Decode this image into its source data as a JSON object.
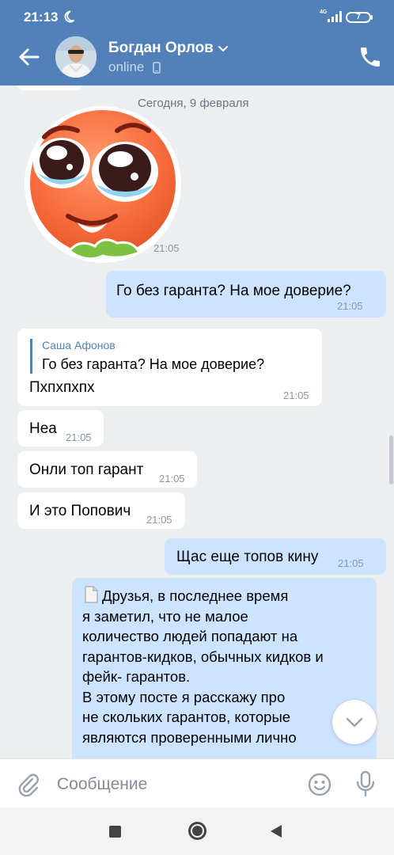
{
  "status_bar": {
    "time": "21:13",
    "network": "4G",
    "battery": "7"
  },
  "header": {
    "contact_name": "Богдан Орлов",
    "status": "online",
    "icons": [
      "back-arrow-icon",
      "chevron-down-icon",
      "mobile-phone-icon",
      "phone-icon"
    ]
  },
  "chat": {
    "date_divider": "Сегодня, 9 февраля",
    "sticker": {
      "icon": "pleading-face-sticker",
      "time": "21:05"
    },
    "messages": [
      {
        "dir": "out",
        "text": "Го без гаранта? На мое доверие?",
        "time": "21:05"
      },
      {
        "dir": "in",
        "reply_author": "Саша Афонов",
        "reply_text": "Го без гаранта? На мое доверие?",
        "text": "Пхпхпхпх",
        "time": "21:05"
      },
      {
        "dir": "in",
        "text": "Неа",
        "time": "21:05"
      },
      {
        "dir": "in",
        "text": "Онли топ гарант",
        "time": "21:05"
      },
      {
        "dir": "in",
        "text": "И это Попович",
        "time": "21:05"
      },
      {
        "dir": "out",
        "text": "Щас еще топов кину",
        "time": "21:05"
      },
      {
        "dir": "out",
        "lines": [
          "Друзья, в последнее время",
          "я заметил, что не малое",
          "количество людей попадают на",
          "гарантов-кидков, обычных кидков и",
          "фейк- гарантов.",
          "В этому посте я расскажу про",
          "не скольких гарантов, которые",
          "являются проверенными лично"
        ]
      }
    ]
  },
  "input": {
    "placeholder": "Сообщение"
  },
  "colors": {
    "header": "#5181b8",
    "outgoing": "#cce4ff",
    "incoming": "#ffffff",
    "background": "#edeef0",
    "link": "#5181b8"
  }
}
